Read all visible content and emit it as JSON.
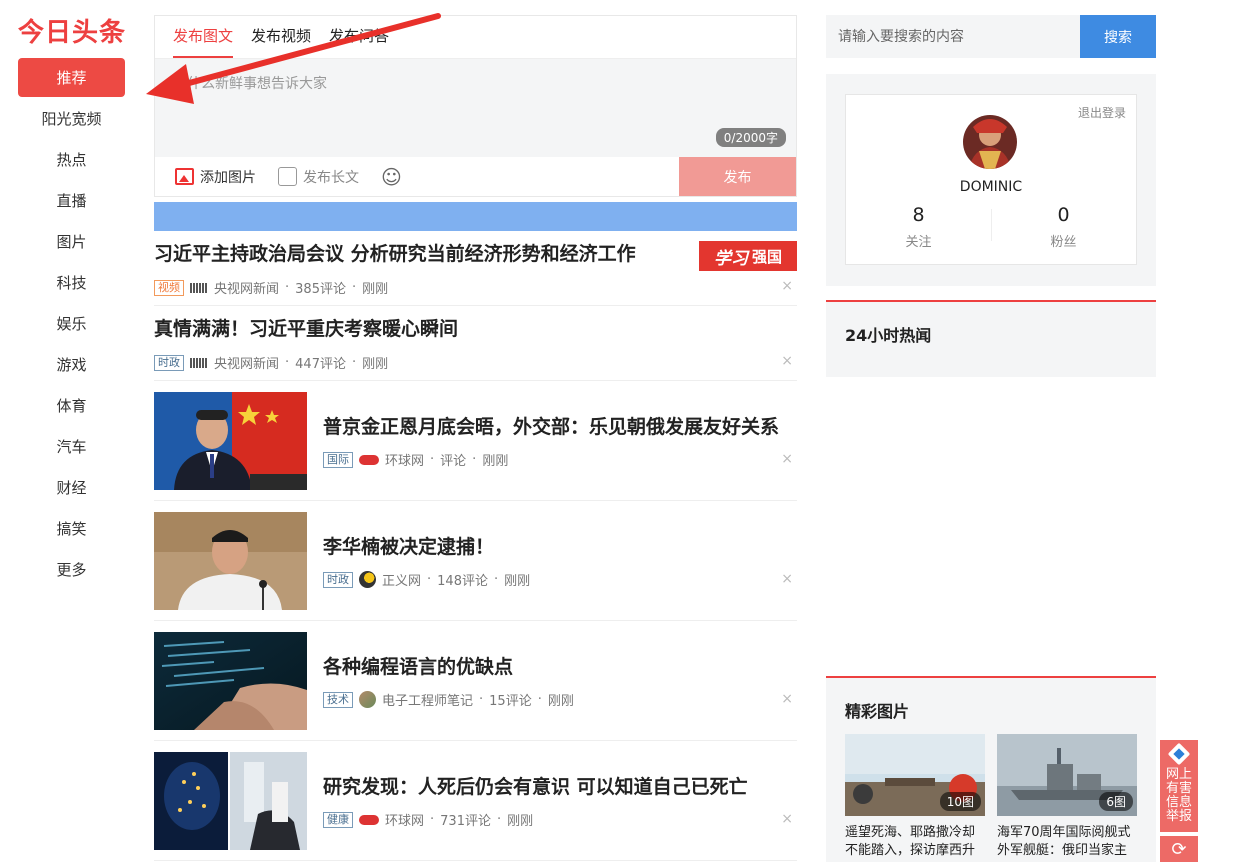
{
  "logo": "今日头条",
  "nav": {
    "items": [
      {
        "label": "推荐",
        "active": true
      },
      {
        "label": "阳光宽频"
      },
      {
        "label": "热点"
      },
      {
        "label": "直播"
      },
      {
        "label": "图片"
      },
      {
        "label": "科技"
      },
      {
        "label": "娱乐"
      },
      {
        "label": "游戏"
      },
      {
        "label": "体育"
      },
      {
        "label": "汽车"
      },
      {
        "label": "财经"
      },
      {
        "label": "搞笑"
      },
      {
        "label": "更多"
      }
    ]
  },
  "publisher": {
    "tabs": [
      "发布图文",
      "发布视频",
      "发布问答"
    ],
    "placeholder": "有什么新鲜事想告诉大家",
    "counter": "0/2000字",
    "add_image": "添加图片",
    "long_post": "发布长文",
    "submit": "发布"
  },
  "feed": [
    {
      "title": "习近平主持政治局会议 分析研究当前经济形势和经济工作",
      "tag": "视频",
      "tag_style": "orange",
      "source": "央视网新闻",
      "comments": "385评论",
      "time": "刚刚",
      "badge": {
        "script": "学习",
        "text": "强国"
      }
    },
    {
      "title": "真情满满！习近平重庆考察暖心瞬间",
      "tag": "时政",
      "source": "央视网新闻",
      "comments": "447评论",
      "time": "刚刚"
    },
    {
      "title": "普京金正恩月底会晤，外交部：乐见朝俄发展友好关系",
      "tag": "国际",
      "source": "环球网",
      "comments": "评论",
      "time": "刚刚"
    },
    {
      "title": "李华楠被决定逮捕！",
      "tag": "时政",
      "source": "正义网",
      "comments": "148评论",
      "time": "刚刚"
    },
    {
      "title": "各种编程语言的优缺点",
      "tag": "技术",
      "source": "电子工程师笔记",
      "comments": "15评论",
      "time": "刚刚"
    },
    {
      "title": "研究发现：人死后仍会有意识 可以知道自己已死亡",
      "tag": "健康",
      "source": "环球网",
      "comments": "731评论",
      "time": "刚刚"
    }
  ],
  "meta_separator": "·",
  "close_glyph": "×",
  "search": {
    "placeholder": "请输入要搜索的内容",
    "button": "搜索"
  },
  "user": {
    "logout": "退出登录",
    "name": "DOMINIC",
    "following": {
      "value": "8",
      "label": "关注"
    },
    "followers": {
      "value": "0",
      "label": "粉丝"
    }
  },
  "hot_news": {
    "title": "24小时热闻"
  },
  "pictures": {
    "title": "精彩图片",
    "items": [
      {
        "count": "10图",
        "caption": "遥望死海、耶路撒冷却不能踏入，探访摩西升"
      },
      {
        "count": "6图",
        "caption": "海军70周年国际阅舰式外军舰艇：俄印当家主"
      }
    ]
  },
  "report": {
    "text": "网上有害信息举报"
  },
  "colors": {
    "brand_red": "#ed4040",
    "search_blue": "#3e8be2",
    "banner_blue": "#7fb0f0",
    "submit_pink": "#f19a95"
  }
}
